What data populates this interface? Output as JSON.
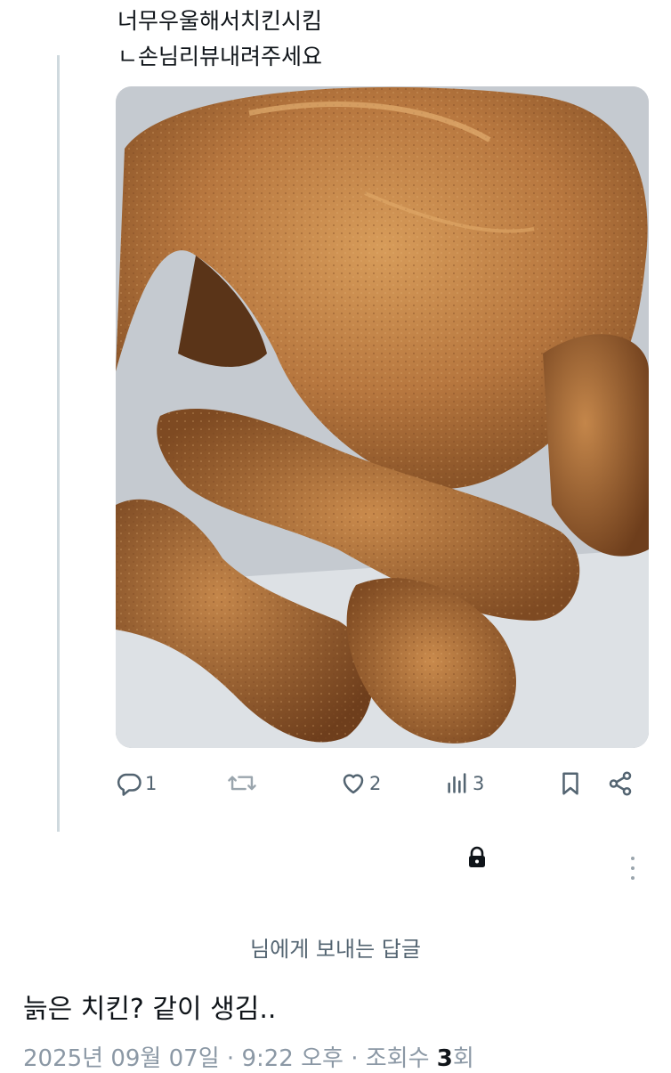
{
  "post": {
    "line1": "너무우울해서치킨시킴",
    "line2": "ㄴ손님리뷰내려주세요"
  },
  "media": {
    "icon": "fried-chicken-photo"
  },
  "actions": {
    "reply_count": "1",
    "like_count": "2",
    "view_count": "3"
  },
  "reply_to_label": "님에게 보내는 답글",
  "reply": {
    "text": "늙은 치킨? 같이 생김.."
  },
  "meta": {
    "date": "2025년 09월 07일",
    "sep1": " · ",
    "time": "9:22 오후",
    "sep2": " · ",
    "views_label": "조회수 ",
    "views_value": "3",
    "views_unit": "회"
  },
  "colors": {
    "text": "#0f1419",
    "muted": "#536471",
    "thread_line": "#cfd9de"
  }
}
